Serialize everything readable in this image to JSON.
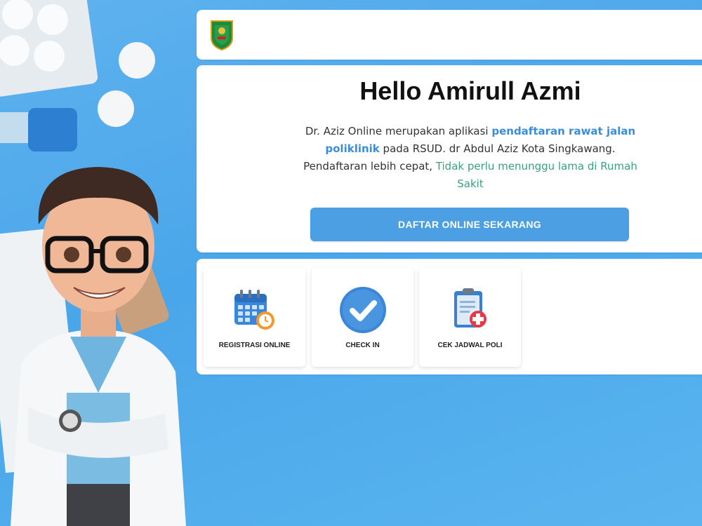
{
  "header": {
    "logo_icon": "regional-emblem-icon"
  },
  "hero": {
    "greeting": "Hello Amirull Azmi",
    "desc_part1": "Dr. Aziz Online merupakan aplikasi ",
    "desc_highlight": "pendaftaran rawat jalan poliklinik",
    "desc_part2": " pada RSUD. dr Abdul Aziz Kota Singkawang. Pendaftaran lebih cepat, ",
    "desc_green": "Tidak perlu menunggu lama di Rumah Sakit",
    "cta_label": "DAFTAR ONLINE SEKARANG"
  },
  "menu": {
    "items": [
      {
        "label": "REGISTRASI ONLINE",
        "icon": "calendar-clock-icon"
      },
      {
        "label": "CHECK IN",
        "icon": "checkmark-circle-icon"
      },
      {
        "label": "CEK JADWAL POLI",
        "icon": "clipboard-medical-icon"
      }
    ]
  },
  "colors": {
    "accent": "#4c9fe2",
    "highlight_blue": "#3b8ed6",
    "highlight_green": "#3ba07b",
    "background": "#5fb2ee"
  }
}
